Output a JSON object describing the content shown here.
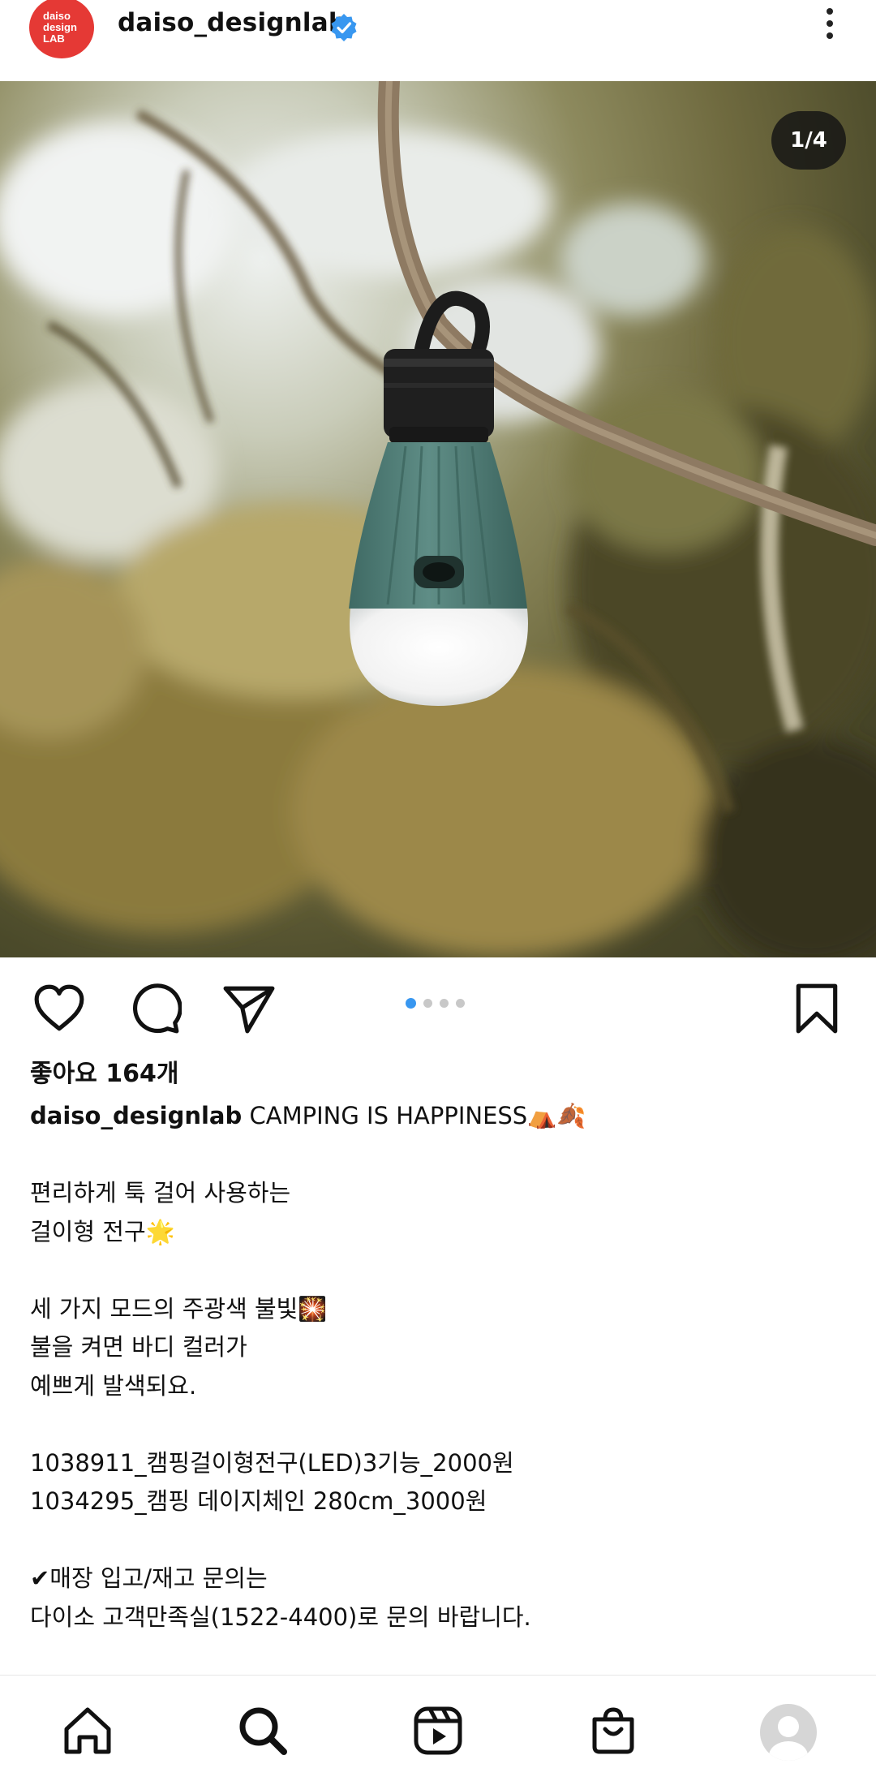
{
  "header": {
    "avatar_line1": "daiso",
    "avatar_line2": "design",
    "avatar_line3": "LAB",
    "username": "daiso_designlab"
  },
  "post": {
    "image_counter": "1/4",
    "carousel": {
      "total": 4,
      "current": 1
    },
    "likes": "좋아요 164개",
    "caption_username": "daiso_designlab",
    "caption_text": " CAMPING IS HAPPINESS⛺🍂\n\n편리하게 툭 걸어 사용하는\n걸이형 전구🌟\n\n세 가지 모드의 주광색 불빛🎇\n불을 켜면 바디 컬러가\n예쁘게 발색되요.\n\n1038911_캠핑걸이형전구(LED)3기능_2000원\n1034295_캠핑 데이지체인 280cm_3000원\n\n✔매장 입고/재고 문의는\n다이소 고객만족실(1522-4400)로 문의 바랍니다."
  },
  "icons": {
    "verified": "verified-badge-icon",
    "more": "more-options-icon",
    "like": "heart-icon",
    "comment": "comment-icon",
    "share": "send-icon",
    "save": "bookmark-icon",
    "home": "home-icon",
    "search": "search-icon",
    "reels": "reels-icon",
    "shop": "shopping-bag-icon"
  },
  "colors": {
    "accent": "#3897f0",
    "brand_avatar": "#e53935"
  }
}
